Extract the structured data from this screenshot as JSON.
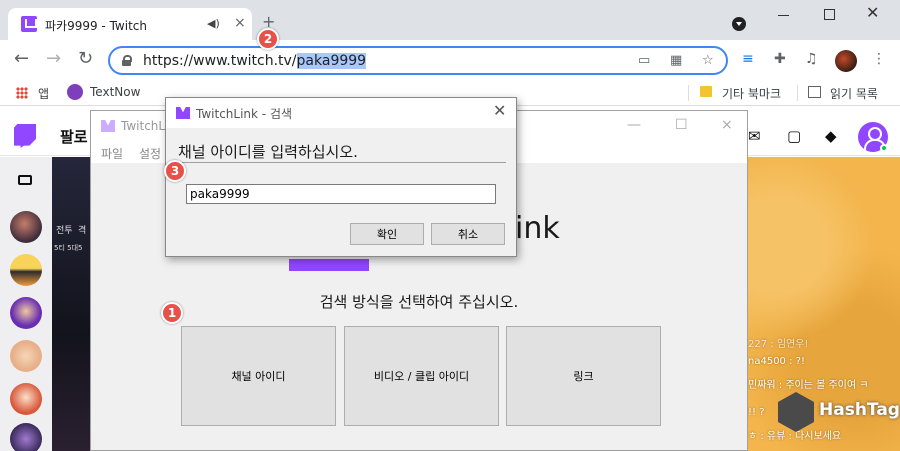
{
  "browser": {
    "tab_title": "파카9999 - Twitch",
    "tab_audio_icon": "speaker-icon",
    "tab_close_icon": "×",
    "new_tab_icon": "+",
    "url_prefix": "https://www.twitch.tv/",
    "url_selected": "paka9999",
    "bookmarks": {
      "apps": "앱",
      "textnow": "TextNow",
      "other": "기타 북마크",
      "reading_list": "읽기 목록"
    }
  },
  "twitch": {
    "nav_following": "팔로",
    "side_icon": "camera-icon",
    "stream_overlay": [
      "전투",
      "격",
      "5티 5대5"
    ],
    "chat_lines": [
      "227 : 임연우!",
      "na4500 : ?!",
      "민짜워 : 주이는 볼 주이여 ㅋ",
      "!! ?",
      "ㅎ : 유뷰 : 다시보세요"
    ]
  },
  "twitchlink": {
    "app_name": "TwitchLink",
    "window_title": "TwitchLi",
    "menu": [
      "파일",
      "설정"
    ],
    "brand_text": "ink",
    "prompt": "검색 방식을 선택하여 주십시오.",
    "choices": [
      "채널 아이디",
      "비디오 / 클립 아이디",
      "링크"
    ],
    "window_controls": {
      "minimize": "—",
      "maximize": "☐",
      "close": "×"
    }
  },
  "dialog": {
    "title_app": "TwitchLink",
    "title_sep": " - ",
    "title_action": "검색",
    "heading": "채널 아이디를 입력하십시오.",
    "input_value": "paka9999",
    "ok_label": "확인",
    "cancel_label": "취소"
  },
  "annotations": {
    "steps": [
      "1",
      "2",
      "3"
    ],
    "color": "#e8504a"
  },
  "watermark": {
    "text": "HashTag",
    "cube_text": "HashTag"
  },
  "colors": {
    "twitch_purple": "#9146ff",
    "focus_blue": "#4285f4",
    "selection_blue": "#a8c7fa"
  }
}
